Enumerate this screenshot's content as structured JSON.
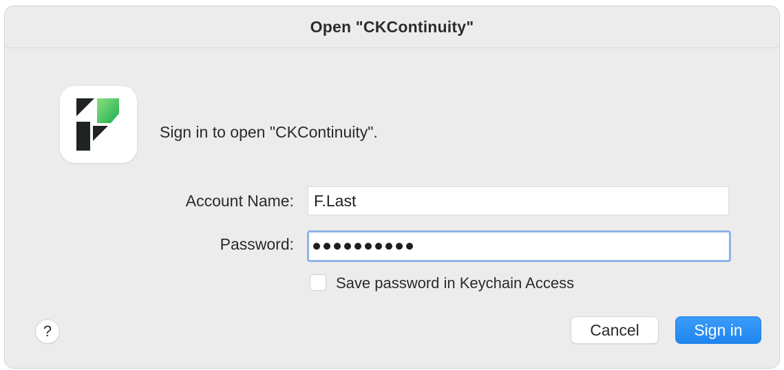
{
  "dialog": {
    "title": "Open \"CKContinuity\"",
    "message": "Sign in to open \"CKContinuity\".",
    "app_icon": "ckcontinuity-app-icon"
  },
  "form": {
    "account_label": "Account Name:",
    "account_value": "F.Last",
    "password_label": "Password:",
    "password_mask_length": 10,
    "save_password_label": "Save password in Keychain Access",
    "save_password_checked": false
  },
  "buttons": {
    "help_label": "?",
    "cancel_label": "Cancel",
    "signin_label": "Sign in"
  },
  "colors": {
    "accent": "#1f86f0",
    "focus_ring": "#8fb2e6",
    "icon_green": "#2fbf5a",
    "icon_dark": "#1f2421"
  }
}
